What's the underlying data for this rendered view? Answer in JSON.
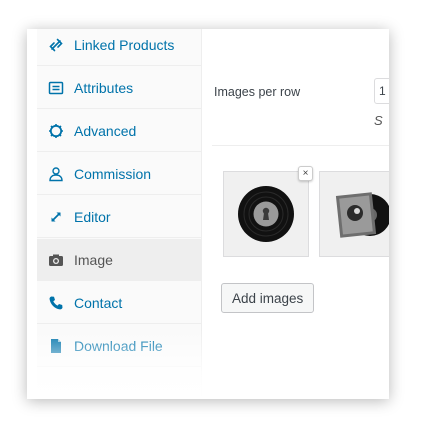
{
  "sidebar": {
    "items": [
      {
        "label": "Linked Products",
        "icon": "link-icon",
        "active": false
      },
      {
        "label": "Attributes",
        "icon": "list-icon",
        "active": false
      },
      {
        "label": "Advanced",
        "icon": "gear-icon",
        "active": false
      },
      {
        "label": "Commission",
        "icon": "user-icon",
        "active": false
      },
      {
        "label": "Editor",
        "icon": "expand-icon",
        "active": false
      },
      {
        "label": "Image",
        "icon": "camera-icon",
        "active": true
      },
      {
        "label": "Contact",
        "icon": "phone-icon",
        "active": false
      },
      {
        "label": "Download File",
        "icon": "file-icon",
        "active": false
      }
    ]
  },
  "content": {
    "images_per_row_label": "Images per row",
    "images_per_row_value": "1",
    "description_prefix": "S",
    "remove_symbol": "×",
    "add_images_label": "Add images",
    "gallery": [
      {
        "icon": "vinyl-record-icon"
      },
      {
        "icon": "album-cover-icon"
      }
    ]
  },
  "colors": {
    "link": "#0073aa",
    "active_text": "#555555",
    "sidebar_bg": "#fafafa",
    "active_bg": "#eeeeee"
  }
}
